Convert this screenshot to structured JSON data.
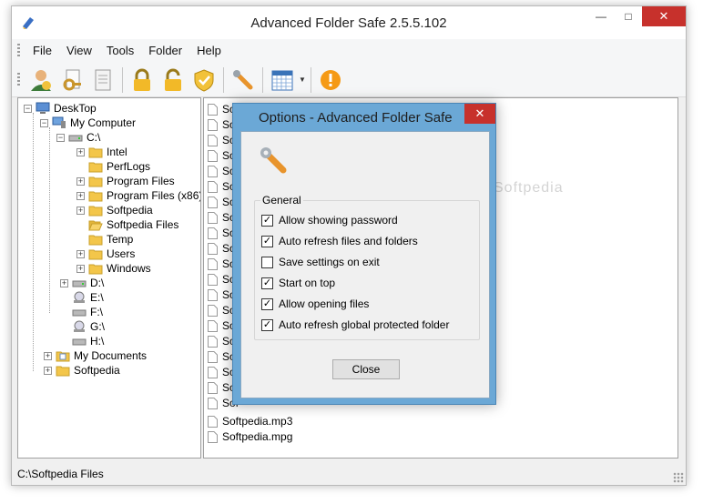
{
  "window": {
    "title": "Advanced Folder Safe 2.5.5.102"
  },
  "menu": [
    "File",
    "View",
    "Tools",
    "Folder",
    "Help"
  ],
  "toolbar": [
    {
      "icon": "user-add-icon"
    },
    {
      "icon": "key-icon"
    },
    {
      "icon": "document-icon"
    },
    {
      "icon": "lock-closed-icon"
    },
    {
      "icon": "lock-open-icon"
    },
    {
      "icon": "shield-icon"
    },
    {
      "icon": "wrench-icon"
    },
    {
      "icon": "calendar-icon"
    },
    {
      "icon": "warning-icon"
    }
  ],
  "tree": {
    "desktop": "DeskTop",
    "my_computer": "My Computer",
    "drive_c": "C:\\",
    "c_children": [
      "Intel",
      "PerfLogs",
      "Program Files",
      "Program Files (x86)",
      "Softpedia",
      "Softpedia Files",
      "Temp",
      "Users",
      "Windows"
    ],
    "drives": [
      "D:\\",
      "E:\\",
      "F:\\",
      "G:\\",
      "H:\\"
    ],
    "my_documents": "My Documents",
    "softpedia": "Softpedia"
  },
  "files": {
    "visible_partial": [
      "Sof",
      "Sof",
      "Sof",
      "Sof",
      "Sof",
      "Sof",
      "Sof",
      "Sof",
      "Sof",
      "Sof",
      "Sof",
      "Sof",
      "Sof",
      "Sof",
      "Sof",
      "Sof",
      "Sof",
      "Sof",
      "Sof",
      "Sof"
    ],
    "visible_full": [
      "Softpedia.mp3",
      "Softpedia.mpg"
    ]
  },
  "statusbar": {
    "path": "C:\\Softpedia Files"
  },
  "watermark": "Softpedia",
  "dialog": {
    "title": "Options - Advanced Folder Safe",
    "group_label": "General",
    "options": [
      {
        "label": "Allow showing password",
        "checked": true
      },
      {
        "label": "Auto refresh files and folders",
        "checked": true
      },
      {
        "label": "Save settings on exit",
        "checked": false
      },
      {
        "label": "Start on top",
        "checked": true
      },
      {
        "label": "Allow opening files",
        "checked": true
      },
      {
        "label": "Auto refresh global protected folder",
        "checked": true
      }
    ],
    "close_button": "Close"
  },
  "colors": {
    "accent": "#6ba8d6",
    "close_red": "#c7312c",
    "folder": "#f3c64a"
  }
}
